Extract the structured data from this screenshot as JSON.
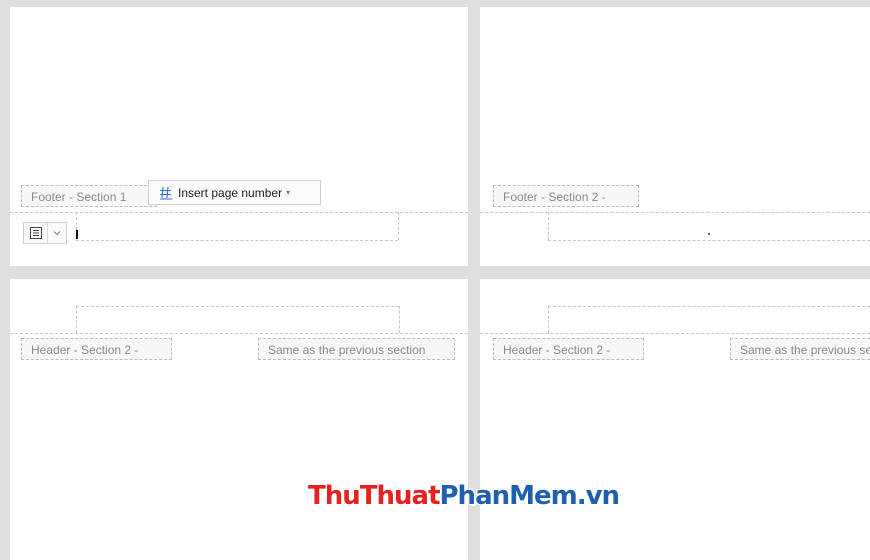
{
  "page1": {
    "footer_label": "Footer  - Section 1",
    "insert_page_number": "Insert page number",
    "insert_icon": "page-number-icon",
    "align_icon": "align-center-icon"
  },
  "page2": {
    "footer_label": "Footer  - Section 2 -"
  },
  "page3": {
    "header_label": "Header  - Section 2 -",
    "link_label": "Same as the previous section"
  },
  "page4": {
    "header_label": "Header  - Section 2 -",
    "link_label": "Same as the previous section"
  },
  "watermark": {
    "part1": "Thu",
    "part2": "Thuat",
    "part3": "Phan",
    "part4": "Mem",
    "part5": ".vn"
  },
  "colors": {
    "watermark_red": "#e52221",
    "watermark_blue": "#1f5fb0"
  }
}
